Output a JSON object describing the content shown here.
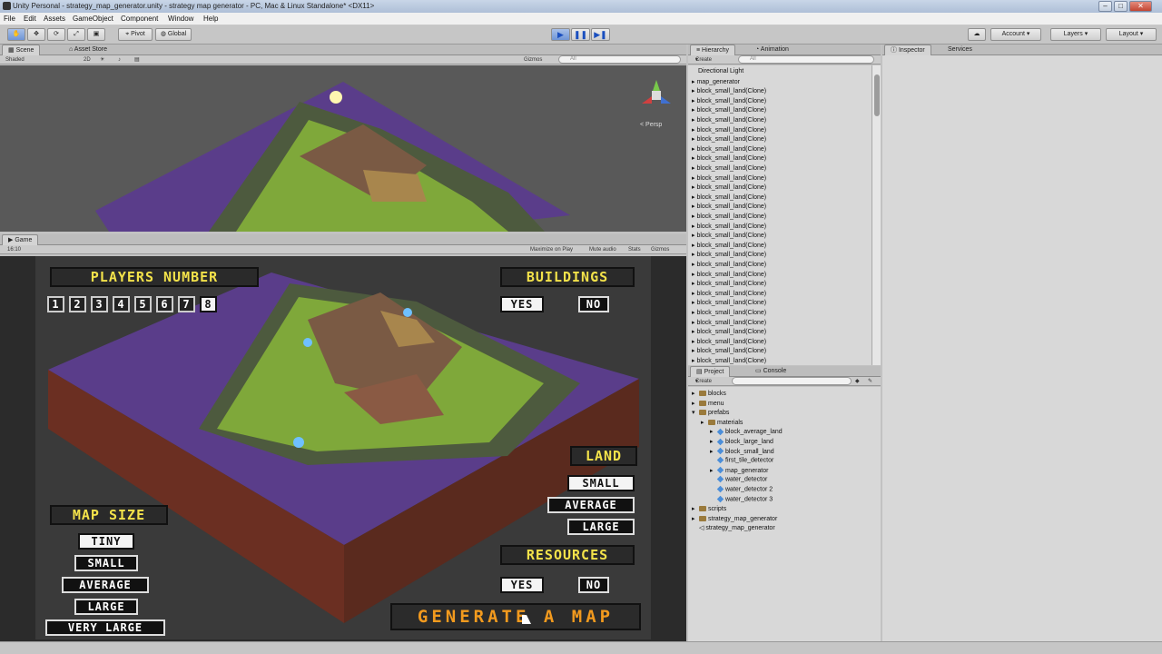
{
  "window": {
    "title": "Unity Personal - strategy_map_generator.unity - strategy map generator - PC, Mac & Linux Standalone* <DX11>"
  },
  "menu": [
    "File",
    "Edit",
    "Assets",
    "GameObject",
    "Component",
    "Window",
    "Help"
  ],
  "toolbar": {
    "pivot": "Pivot",
    "global": "Global",
    "account": "Account",
    "layers": "Layers",
    "layout": "Layout"
  },
  "scene": {
    "tab": "Scene",
    "asset_tab": "Asset Store",
    "shading": "Shaded",
    "mode2d": "2D",
    "gizmos": "Gizmos",
    "search_placeholder": "All",
    "persp": "< Persp"
  },
  "game": {
    "tab": "Game",
    "aspect": "16:10",
    "maximize": "Maximize on Play",
    "mute": "Mute audio",
    "stats": "Stats",
    "gizmos": "Gizmos"
  },
  "ui": {
    "players_header": "PLAYERS NUMBER",
    "players": [
      "1",
      "2",
      "3",
      "4",
      "5",
      "6",
      "7",
      "8"
    ],
    "players_selected": "8",
    "buildings_header": "BUILDINGS",
    "buildings_yes": "YES",
    "buildings_no": "NO",
    "land_header": "LAND",
    "land_small": "SMALL",
    "land_average": "AVERAGE",
    "land_large": "LARGE",
    "map_size_header": "MAP SIZE",
    "size_tiny": "TINY",
    "size_small": "SMALL",
    "size_average": "AVERAGE",
    "size_large": "LARGE",
    "size_very_large": "VERY LARGE",
    "resources_header": "RESOURCES",
    "resources_yes": "YES",
    "resources_no": "NO",
    "generate": "GENERATE A MAP"
  },
  "hierarchy": {
    "tab": "Hierarchy",
    "animation_tab": "Animation",
    "create": "Create",
    "search_placeholder": "All",
    "items": [
      "Directional Light",
      "map_generator",
      "block_small_land(Clone)",
      "block_small_land(Clone)",
      "block_small_land(Clone)",
      "block_small_land(Clone)",
      "block_small_land(Clone)",
      "block_small_land(Clone)",
      "block_small_land(Clone)",
      "block_small_land(Clone)",
      "block_small_land(Clone)",
      "block_small_land(Clone)",
      "block_small_land(Clone)",
      "block_small_land(Clone)",
      "block_small_land(Clone)",
      "block_small_land(Clone)",
      "block_small_land(Clone)",
      "block_small_land(Clone)",
      "block_small_land(Clone)",
      "block_small_land(Clone)",
      "block_small_land(Clone)",
      "block_small_land(Clone)",
      "block_small_land(Clone)",
      "block_small_land(Clone)",
      "block_small_land(Clone)",
      "block_small_land(Clone)",
      "block_small_land(Clone)",
      "block_small_land(Clone)",
      "block_small_land(Clone)",
      "block_small_land(Clone)",
      "block_small_land(Clone)",
      "block_small_land(Clone)"
    ]
  },
  "project": {
    "tab": "Project",
    "console_tab": "Console",
    "create": "Create",
    "items": [
      "blocks",
      "menu",
      "prefabs",
      "materials",
      "block_average_land",
      "block_large_land",
      "block_small_land",
      "first_tile_detector",
      "map_generator",
      "water_detector",
      "water_detector 2",
      "water_detector 3",
      "scripts",
      "strategy_map_generator",
      "strategy_map_generator"
    ]
  },
  "inspector": {
    "tab": "Inspector",
    "services_tab": "Services"
  },
  "colors": {
    "yellow": "#f3e24a",
    "orange": "#f29a1e",
    "purple": "#5a3d8a",
    "grass": "#7fa83a"
  }
}
